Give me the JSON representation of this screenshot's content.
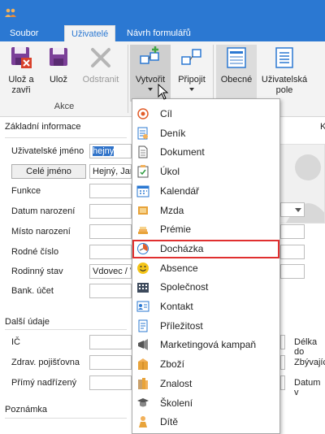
{
  "tabs": [
    {
      "label": "Soubor",
      "active": false
    },
    {
      "label": "Uživatelé",
      "active": true
    },
    {
      "label": "Návrh formulářů",
      "active": false
    }
  ],
  "ribbon": {
    "save_close_label_1": "Ulož a",
    "save_close_label_2": "zavři",
    "save_label": "Ulož",
    "delete_label": "Odstranit",
    "group_actions": "Akce",
    "create_label": "Vytvořit",
    "attach_label": "Připojit",
    "general_label": "Obecné",
    "user_fields_label_1": "Uživatelská",
    "user_fields_label_2": "pole"
  },
  "form": {
    "basic_info": "Základní informace",
    "username_label": "Uživatelské jméno",
    "username_value": "hejny",
    "fullname_button": "Celé jméno",
    "fullname_value": "Hejný, Jar",
    "function_label": "Funkce",
    "birth_date_label": "Datum narození",
    "birth_place_label": "Místo narození",
    "birth_number_label": "Rodné číslo",
    "marital_status_label": "Rodinný stav",
    "marital_status_value": "Vdovec / V",
    "bank_account_label": "Bank. účet",
    "more_info": "Další údaje",
    "ic_label": "IČ",
    "insurance_label": "Zdrav. pojišťovna",
    "supervisor_label": "Přímý nadřízený",
    "length_label": "Délka do",
    "remaining_label": "Zbývajíc",
    "date_label": "Datum v",
    "note_label": "Poznámka",
    "right_marker": "K"
  },
  "menu": [
    {
      "label": "Cíl",
      "icon": "target-icon"
    },
    {
      "label": "Deník",
      "icon": "diary-icon"
    },
    {
      "label": "Dokument",
      "icon": "document-icon"
    },
    {
      "label": "Úkol",
      "icon": "task-icon"
    },
    {
      "label": "Kalendář",
      "icon": "calendar-icon"
    },
    {
      "label": "Mzda",
      "icon": "wage-icon"
    },
    {
      "label": "Prémie",
      "icon": "bonus-icon"
    },
    {
      "label": "Docházka",
      "icon": "attendance-icon",
      "highlighted": true
    },
    {
      "label": "Absence",
      "icon": "absence-smiley-icon"
    },
    {
      "label": "Společnost",
      "icon": "company-icon"
    },
    {
      "label": "Kontakt",
      "icon": "contact-icon"
    },
    {
      "label": "Příležitost",
      "icon": "opportunity-icon"
    },
    {
      "label": "Marketingová kampaň",
      "icon": "megaphone-icon"
    },
    {
      "label": "Zboží",
      "icon": "goods-icon"
    },
    {
      "label": "Znalost",
      "icon": "knowledge-icon"
    },
    {
      "label": "Školení",
      "icon": "training-icon"
    },
    {
      "label": "Dítě",
      "icon": "child-icon"
    }
  ],
  "colors": {
    "accent": "#2b78d2",
    "highlight_border": "#e03030",
    "selected_text_bg": "#3073c9"
  }
}
